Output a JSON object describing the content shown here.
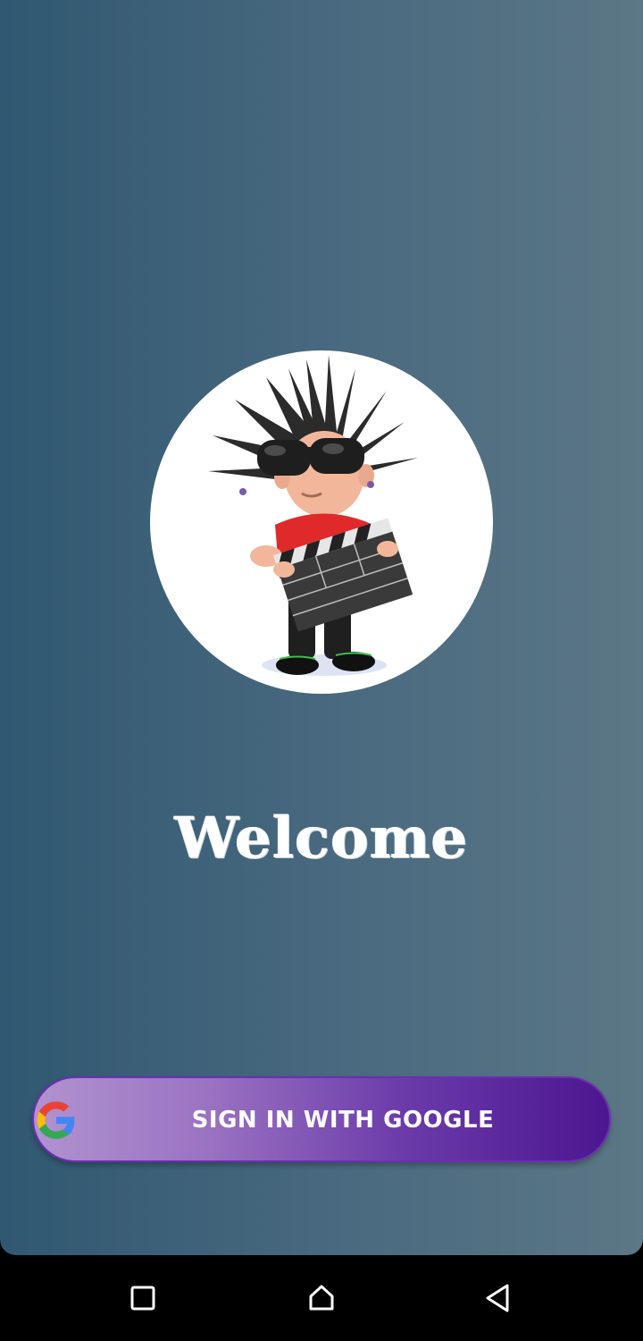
{
  "welcome_text": "Welcome",
  "signin": {
    "label": "SIGN IN WITH GOOGLE",
    "icon": "google-icon"
  },
  "avatar": {
    "description_icon": "punk-character-clapperboard-image"
  },
  "navbar": {
    "recents_icon": "square-icon",
    "home_icon": "home-icon",
    "back_icon": "back-triangle-icon"
  },
  "colors": {
    "background_start": "#305871",
    "background_end": "#5c7785",
    "button_start": "#b192cf",
    "button_end": "#4c1690",
    "text": "#ffffff"
  }
}
